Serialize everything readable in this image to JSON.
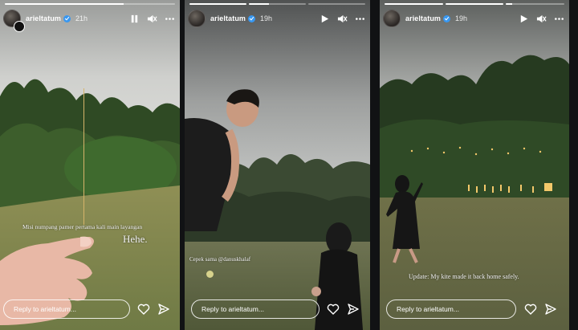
{
  "stories": [
    {
      "username": "arieltatum",
      "time": "21h",
      "caption_small": "Misi numpang pamer pertama kali main layangan",
      "caption_large": "Hehe.",
      "reply_placeholder": "Reply to arieltatum..."
    },
    {
      "username": "arieltatum",
      "time": "19h",
      "caption_small": "Cepek sama @danuskhalaf",
      "reply_placeholder": "Reply to arieltatum..."
    },
    {
      "username": "arieltatum",
      "time": "19h",
      "caption_small": "Update: My kite made it back home safely.",
      "reply_placeholder": "Reply to arieltatum..."
    }
  ],
  "colors": {
    "verified": "#3897f0",
    "grass": "#8a8a52",
    "sky": "#c9c9c7"
  },
  "icons": [
    "pause-icon",
    "play-icon",
    "mute-icon",
    "more-icon",
    "heart-icon",
    "send-icon"
  ]
}
